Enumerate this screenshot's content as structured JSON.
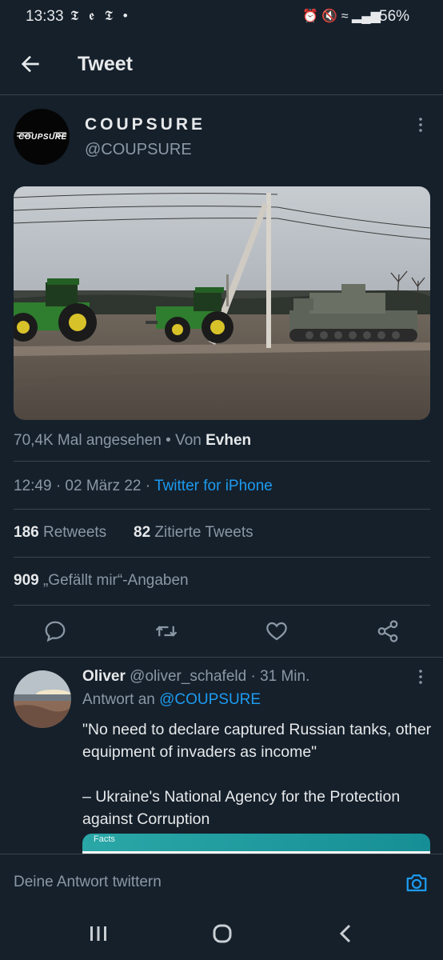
{
  "status_bar": {
    "time": "13:33",
    "left_icons": "𝕿 𝖊 𝕿 •",
    "right_icons": "⏰ 🔇 ≈ ▂▄▆",
    "battery": "56%"
  },
  "header": {
    "title": "Tweet"
  },
  "tweet": {
    "display_name": "COUPSURE",
    "handle": "@COUPSURE",
    "avatar_logo_text": "COUPSURE",
    "views_prefix": "70,4K Mal angesehen • Von",
    "views_author": "Evhen",
    "time": "12:49 · 02 März 22 ·",
    "source": "Twitter for iPhone",
    "retweets_count": "186",
    "retweets_label": "Retweets",
    "quotes_count": "82",
    "quotes_label": "Zitierte Tweets",
    "likes_count": "909",
    "likes_label": "„Gefällt mir“-Angaben"
  },
  "reply": {
    "name": "Oliver",
    "handle_time": "@oliver_schafeld · 31 Min.",
    "reply_to_prefix": "Antwort an",
    "reply_to_handle": "@COUPSURE",
    "text": "\"No need to declare captured Russian tanks, other equipment of invaders as income\"\n\n – Ukraine's National Agency for the Protection against Corruption",
    "card_label": "Facts"
  },
  "compose": {
    "placeholder": "Deine Antwort twittern"
  },
  "colors": {
    "background": "#15202b",
    "accent": "#1d9bf0",
    "muted": "#8b98a5",
    "divider": "#38444d"
  },
  "icons": [
    "back-arrow-icon",
    "more-icon",
    "reply-icon",
    "retweet-icon",
    "like-icon",
    "share-icon",
    "camera-icon",
    "recents-icon",
    "home-icon",
    "back-nav-icon"
  ]
}
